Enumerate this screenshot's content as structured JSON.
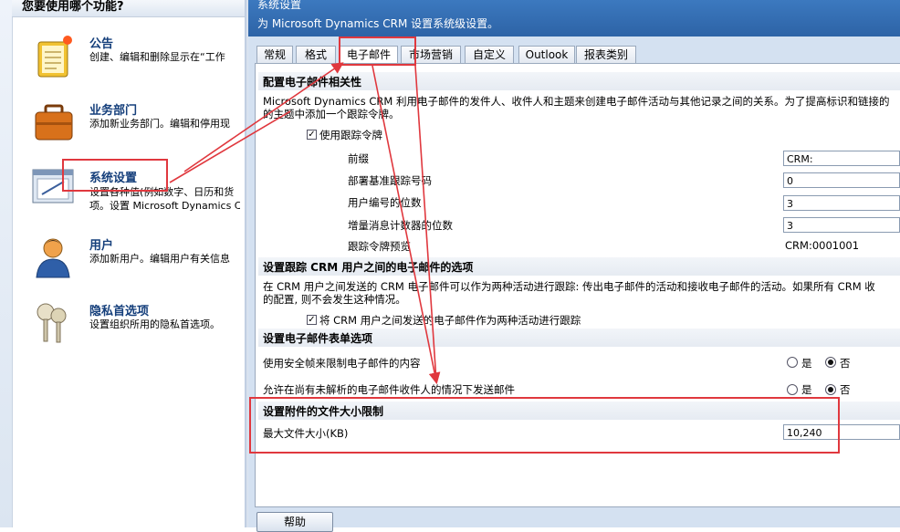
{
  "left": {
    "title": "您要使用哪个功能?",
    "items": [
      {
        "title": "公告",
        "desc": "创建、编辑和删除显示在“工作",
        "icon": "notepad-icon"
      },
      {
        "title": "业务部门",
        "desc": "添加新业务部门。编辑和停用现",
        "icon": "briefcase-icon"
      },
      {
        "title": "系统设置",
        "desc": "设置各种值(例如数字、日历和货",
        "desc2": "项。设置  Microsoft Dynamics C",
        "icon": "settings-window-icon"
      },
      {
        "title": "用户",
        "desc": "添加新用户。编辑用户有关信息",
        "icon": "user-icon"
      },
      {
        "title": "隐私首选项",
        "desc": "设置组织所用的隐私首选项。",
        "icon": "keys-icon"
      }
    ]
  },
  "dialog": {
    "title": "系统设置",
    "subtitle": "为 Microsoft Dynamics CRM 设置系统级设置。",
    "tabs": [
      "常规",
      "格式",
      "电子邮件",
      "市场营销",
      "自定义",
      "Outlook",
      "报表类别"
    ],
    "active_tab": "电子邮件"
  },
  "email": {
    "sec1_title": "配置电子邮件相关性",
    "sec1_desc1": "Microsoft Dynamics CRM 利用电子邮件的发件人、收件人和主题来创建电子邮件活动与其他记录之间的关系。为了提高标识和链接的",
    "sec1_desc2": "的主题中添加一个跟踪令牌。",
    "use_token_label": "使用跟踪令牌",
    "use_token_checked": true,
    "prefix_label": "前缀",
    "prefix_value": "CRM:",
    "deploy_label": "部署基准跟踪号码",
    "deploy_value": "0",
    "user_digits_label": "用户编号的位数",
    "user_digits_value": "3",
    "counter_digits_label": "增量消息计数器的位数",
    "counter_digits_value": "3",
    "preview_label": "跟踪令牌预览",
    "preview_value": "CRM:0001001",
    "sec2_title": "设置跟踪  CRM 用户之间的电子邮件的选项",
    "sec2_desc1": "在  CRM 用户之间发送的  CRM 电子邮件可以作为两种活动进行跟踪: 传出电子邮件的活动和接收电子邮件的活动。如果所有  CRM 收",
    "sec2_desc2": "的配置, 则不会发生这种情况。",
    "track_two_label": "将  CRM 用户之间发送的电子邮件作为两种活动进行跟踪",
    "track_two_checked": true,
    "sec3_title": "设置电子邮件表单选项",
    "secure_frames_label": "使用安全帧来限制电子邮件的内容",
    "unresolved_label": "允许在尚有未解析的电子邮件收件人的情况下发送邮件",
    "yes_label": "是",
    "no_label": "否",
    "sec4_title": "设置附件的文件大小限制",
    "max_size_label": "最大文件大小(KB)",
    "max_size_value": "10,240"
  },
  "help_button": "帮助",
  "colors": {
    "annotation_red": "#e0383e",
    "header_blue": "#3c79bf",
    "panel_bg": "#d4e1f1"
  }
}
